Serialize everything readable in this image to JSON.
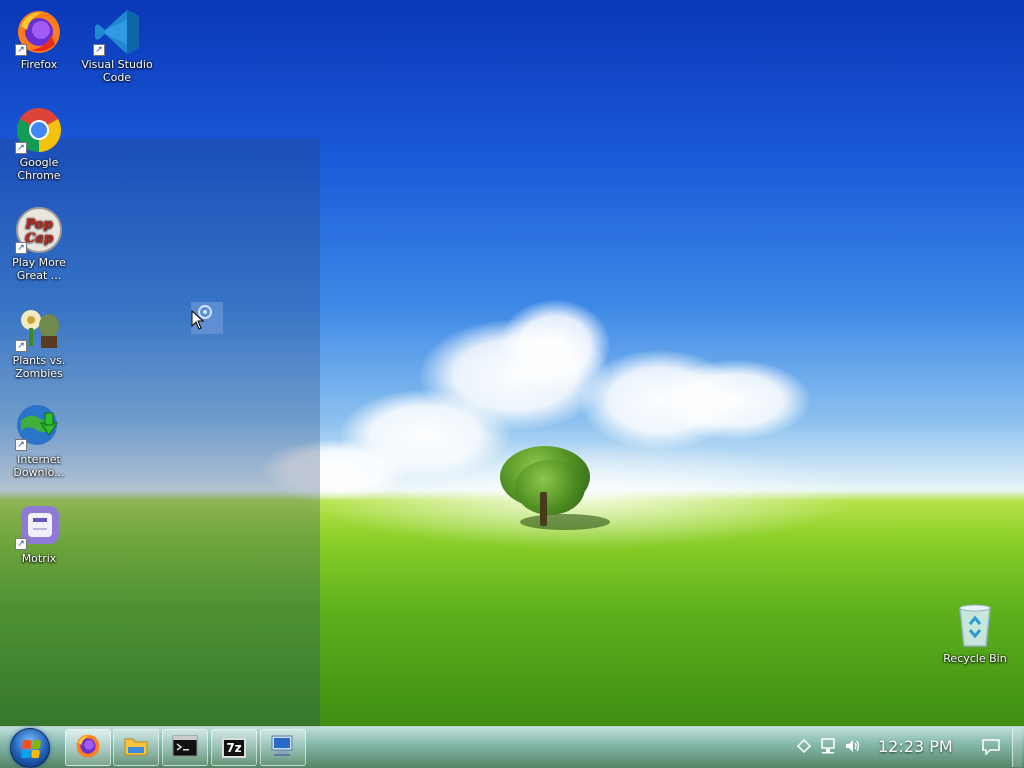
{
  "desktop": {
    "icons": [
      {
        "label": "Firefox",
        "icon": "firefox-icon"
      },
      {
        "label": "Visual Studio Code",
        "icon": "vscode-icon"
      },
      {
        "label": "Google Chrome",
        "icon": "chrome-icon"
      },
      {
        "label": "Play More Great ...",
        "icon": "popcap-icon"
      },
      {
        "label": "Plants vs. Zombies",
        "icon": "plants-vs-zombies-icon"
      },
      {
        "label": "Internet Downlo...",
        "icon": "internet-download-manager-icon"
      },
      {
        "label": "Motrix",
        "icon": "motrix-icon"
      },
      {
        "label": "Recycle Bin",
        "icon": "recycle-bin-icon"
      }
    ]
  },
  "taskbar": {
    "start": {
      "icon": "windows-logo-icon"
    },
    "pinned": [
      {
        "name": "firefox",
        "icon": "firefox-icon",
        "active": true
      },
      {
        "name": "file-explorer",
        "icon": "folder-icon"
      },
      {
        "name": "command-prompt",
        "icon": "terminal-icon"
      },
      {
        "name": "7-zip",
        "icon": "7zip-icon",
        "glyph_text": "7z"
      },
      {
        "name": "network-connection",
        "icon": "network-computer-icon"
      }
    ],
    "tray": {
      "icons": [
        "show-hidden-icons-icon",
        "network-icon",
        "volume-icon"
      ],
      "clock": "12:23 PM",
      "notification_icon": "action-center-icon"
    }
  },
  "colors": {
    "sky_top": "#0a37b8",
    "grass": "#5eb11c",
    "taskbar": "#9cc8a8",
    "selection": "#28406e"
  }
}
